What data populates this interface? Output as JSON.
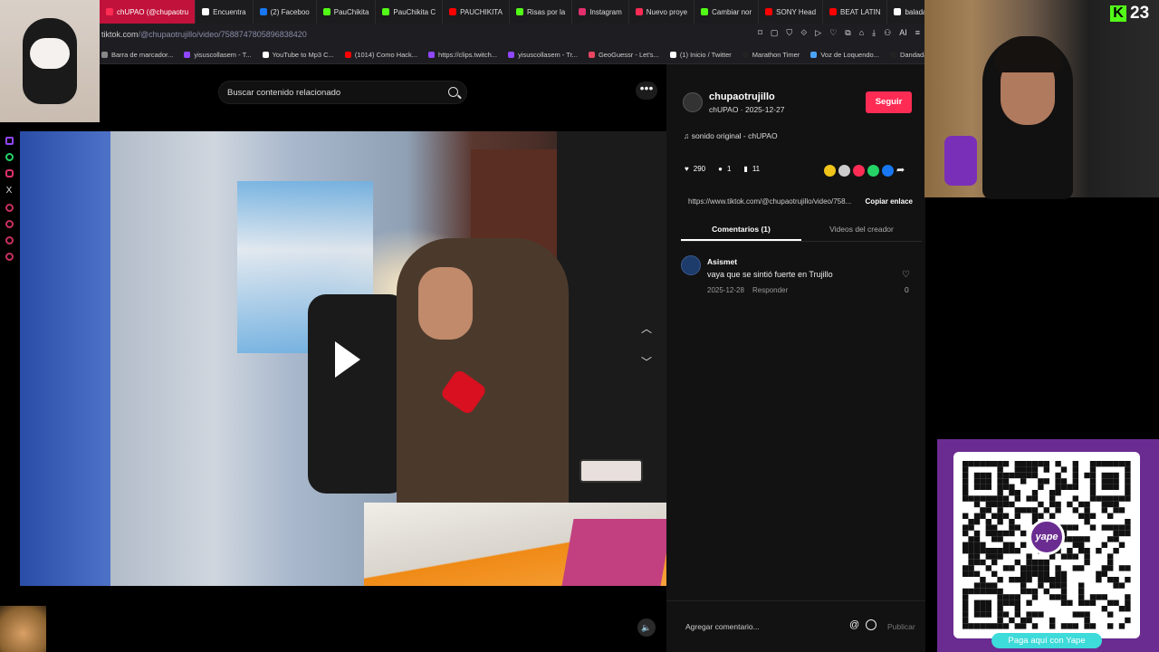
{
  "browser": {
    "tabs": [
      {
        "label": "chUPAO (@chupaotru",
        "active": true,
        "color": "#fe2c55"
      },
      {
        "label": "Encuentra",
        "color": "#ffffff"
      },
      {
        "label": "(2) Faceboo",
        "color": "#1877f2"
      },
      {
        "label": "PauChikita",
        "color": "#53fc18"
      },
      {
        "label": "PauChikita C",
        "color": "#53fc18"
      },
      {
        "label": "PAUCHIKITA",
        "color": "#ff0000"
      },
      {
        "label": "Risas por la",
        "color": "#53fc18"
      },
      {
        "label": "Instagram",
        "color": "#e1306c"
      },
      {
        "label": "Nuevo proye",
        "color": "#fe2c55"
      },
      {
        "label": "Cambiar nor",
        "color": "#53fc18"
      },
      {
        "label": "SONY Head",
        "color": "#ff0000"
      },
      {
        "label": "BEAT LATIN",
        "color": "#ff0000"
      },
      {
        "label": "balada en in",
        "color": "#ffffff"
      }
    ],
    "new_tab_label": "+",
    "url_host": "tiktok.com",
    "url_path": "/@chupaotrujillo/video/7588747805896838420",
    "url_ai_label": "AI",
    "bookmarks": [
      {
        "label": "Barra de marcador...",
        "color": "#888888"
      },
      {
        "label": "yisuscollasem - T...",
        "color": "#9146ff"
      },
      {
        "label": "YouTube to Mp3 C...",
        "color": "#ffffff"
      },
      {
        "label": "(1014) Como Hack...",
        "color": "#ff0000"
      },
      {
        "label": "https://clips.twitch...",
        "color": "#9146ff"
      },
      {
        "label": "yisuscollasem - Tr...",
        "color": "#9146ff"
      },
      {
        "label": "GeoGuessr - Let's...",
        "color": "#e94560"
      },
      {
        "label": "(1) Inicio / Twitter",
        "color": "#ffffff"
      },
      {
        "label": "Marathon Timer",
        "color": "#222222"
      },
      {
        "label": "Voz de Loquendo...",
        "color": "#4aa3ff"
      },
      {
        "label": "Dandadan, Capitul...",
        "color": "#222222"
      }
    ]
  },
  "page": {
    "search_placeholder": "Buscar contenido relacionado",
    "more_label": "•••"
  },
  "video_panel": {
    "username": "chupaotrujillo",
    "subline": "chUPAO · 2025-12-27",
    "follow_label": "Seguir",
    "sound": "sonido original - chUPAO",
    "likes": "290",
    "comments": "1",
    "saves": "11",
    "link": "https://www.tiktok.com/@chupaotrujillo/video/758...",
    "copy_label": "Copiar enlace",
    "tab_comments": "Comentarios (1)",
    "tab_videos": "Videos del creador",
    "share_colors": [
      "#f0c419",
      "#cccccc",
      "#fe2c55",
      "#25d366",
      "#1877f2"
    ]
  },
  "comment": {
    "user": "Asismet",
    "text": "vaya que se sintió fuerte en Trujillo",
    "date": "2025-12-28",
    "reply_label": "Responder",
    "likes": "0"
  },
  "composer": {
    "placeholder": "Agregar comentario...",
    "at_label": "@",
    "publish_label": "Publicar"
  },
  "overlays": {
    "kick_viewers": "23",
    "kick_logo": "K",
    "yape_badge": "yape",
    "yape_cta": "Paga aquí con Yape"
  }
}
